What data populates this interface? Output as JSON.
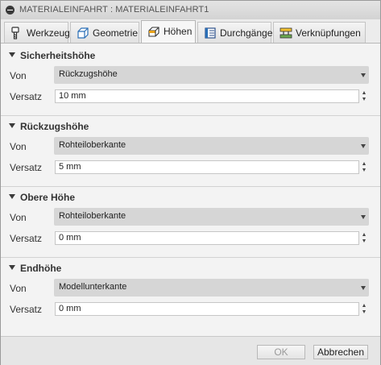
{
  "dialog": {
    "title": "MATERIALEINFAHRT : MATERIALEINFAHRT1"
  },
  "tabs": [
    {
      "label": "Werkzeug",
      "icon": "tool-icon",
      "active": false
    },
    {
      "label": "Geometrie",
      "icon": "geometry-icon",
      "active": false
    },
    {
      "label": "Höhen",
      "icon": "heights-icon",
      "active": true
    },
    {
      "label": "Durchgänge",
      "icon": "passes-icon",
      "active": false
    },
    {
      "label": "Verknüpfungen",
      "icon": "linking-icon",
      "active": false
    }
  ],
  "sections": [
    {
      "title": "Sicherheitshöhe",
      "from_label": "Von",
      "from_value": "Rückzugshöhe",
      "offset_label": "Versatz",
      "offset_value": "10 mm"
    },
    {
      "title": "Rückzugshöhe",
      "from_label": "Von",
      "from_value": "Rohteiloberkante",
      "offset_label": "Versatz",
      "offset_value": "5 mm"
    },
    {
      "title": "Obere Höhe",
      "from_label": "Von",
      "from_value": "Rohteiloberkante",
      "offset_label": "Versatz",
      "offset_value": "0 mm"
    },
    {
      "title": "Endhöhe",
      "from_label": "Von",
      "from_value": "Modellunterkante",
      "offset_label": "Versatz",
      "offset_value": "0 mm"
    }
  ],
  "footer": {
    "ok_label": "OK",
    "ok_enabled": false,
    "cancel_label": "Abbrechen"
  },
  "colors": {
    "tool_blue": "#2b6fb6",
    "orange": "#e8a21a",
    "link_green": "#6aa84f",
    "link_yellow": "#f2c12e"
  }
}
